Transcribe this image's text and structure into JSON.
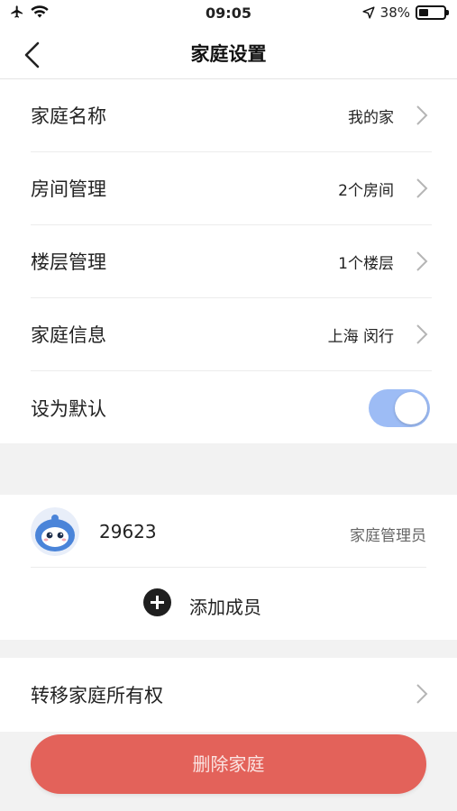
{
  "status_bar": {
    "time": "09:05",
    "battery": "38%",
    "battery_level": 0.38
  },
  "nav": {
    "title": "家庭设置",
    "back_icon": "chevron-left-icon"
  },
  "settings": [
    {
      "label": "家庭名称",
      "value": "我的家"
    },
    {
      "label": "房间管理",
      "value": "2个房间"
    },
    {
      "label": "楼层管理",
      "value": "1个楼层"
    },
    {
      "label": "家庭信息",
      "value": "上海 闵行"
    }
  ],
  "default_toggle": {
    "label": "设为默认",
    "on": true,
    "color": "#9dbcf5"
  },
  "members": [
    {
      "name": "29623",
      "role": "家庭管理员"
    }
  ],
  "add_member": {
    "label": "添加成员"
  },
  "transfer": {
    "label": "转移家庭所有权"
  },
  "delete_button": {
    "label": "删除家庭",
    "color": "#e3625a"
  }
}
